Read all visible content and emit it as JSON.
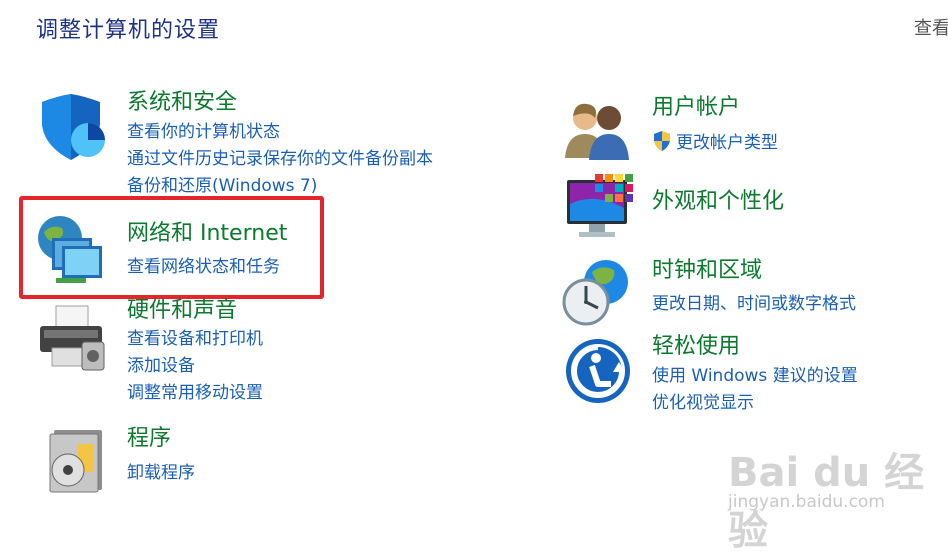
{
  "header": {
    "title": "调整计算机的设置",
    "view_by": "查看"
  },
  "categories": {
    "system": {
      "title": "系统和安全",
      "icon": "shield-icon",
      "links": [
        "查看你的计算机状态",
        "通过文件历史记录保存你的文件备份副本",
        "备份和还原(Windows 7)"
      ]
    },
    "network": {
      "title": "网络和 Internet",
      "icon": "network-globe-icon",
      "links": [
        "查看网络状态和任务"
      ]
    },
    "hardware": {
      "title": "硬件和声音",
      "icon": "printer-icon",
      "links": [
        "查看设备和打印机",
        "添加设备",
        "调整常用移动设置"
      ]
    },
    "programs": {
      "title": "程序",
      "icon": "programs-disc-icon",
      "links": [
        "卸载程序"
      ]
    },
    "users": {
      "title": "用户帐户",
      "icon": "users-icon",
      "links": [
        "更改帐户类型"
      ]
    },
    "appearance": {
      "title": "外观和个性化",
      "icon": "monitor-color-icon"
    },
    "clock": {
      "title": "时钟和区域",
      "icon": "clock-globe-icon",
      "links": [
        "更改日期、时间或数字格式"
      ]
    },
    "ease": {
      "title": "轻松使用",
      "icon": "ease-of-access-icon",
      "links": [
        "使用 Windows 建议的设置",
        "优化视觉显示"
      ]
    }
  },
  "watermark": {
    "brand": "Bai du 经验",
    "sub": "jingyan.baidu.com"
  },
  "colors": {
    "title_blue": "#1e3287",
    "category_green": "#0b7a2e",
    "link_blue": "#1a5fb4",
    "highlight_red": "#e2262b"
  }
}
